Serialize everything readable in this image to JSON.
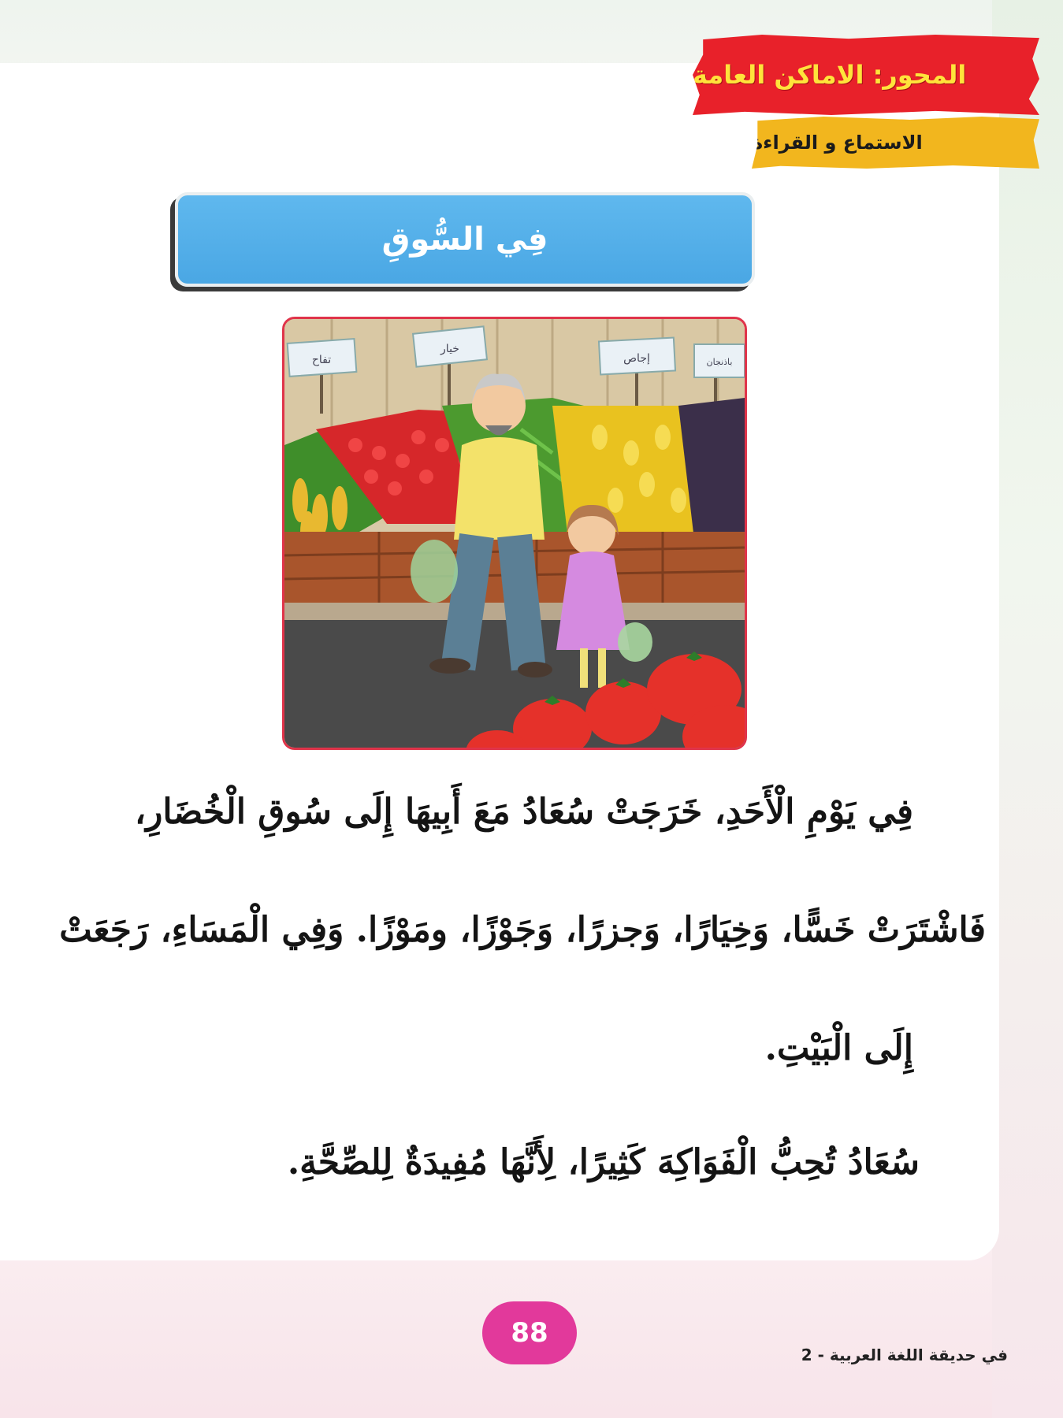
{
  "header": {
    "topic": "المحور: الاماكن العامة",
    "section": "الاستماع و القراءة"
  },
  "lesson": {
    "title": "فِي السُّوقِ"
  },
  "illustration": {
    "signs": [
      "تفاح",
      "خيار",
      "إجاص",
      "باذنجان"
    ]
  },
  "reading": {
    "lines": [
      "فِي يَوْمِ الْأَحَدِ، خَرَجَتْ سُعَادُ مَعَ أَبِيهَا إِلَى سُوقِ الْخُضَارِ،",
      "فَاشْتَرَتْ خَسًّا، وَخِيَارًا، وَجزرًا، وَجَوْزًا، ومَوْزًا. وَفِي الْمَسَاءِ، رَجَعَتْ",
      "إِلَى الْبَيْتِ.",
      "سُعَادُ تُحِبُّ الْفَوَاكِهَ كَثِيرًا، لِأَنَّهَا مُفِيدَةٌ لِلصِّحَّةِ."
    ]
  },
  "footer": {
    "page_number": "88",
    "book_title": "في حديقة اللغة العربية - 2"
  },
  "colors": {
    "topic_banner": "#e8212a",
    "topic_text": "#ffe33b",
    "section_banner": "#f2b61e",
    "title_bar": "#4aa7e4",
    "page_badge": "#e2399b",
    "illustration_border": "#e0344a"
  }
}
